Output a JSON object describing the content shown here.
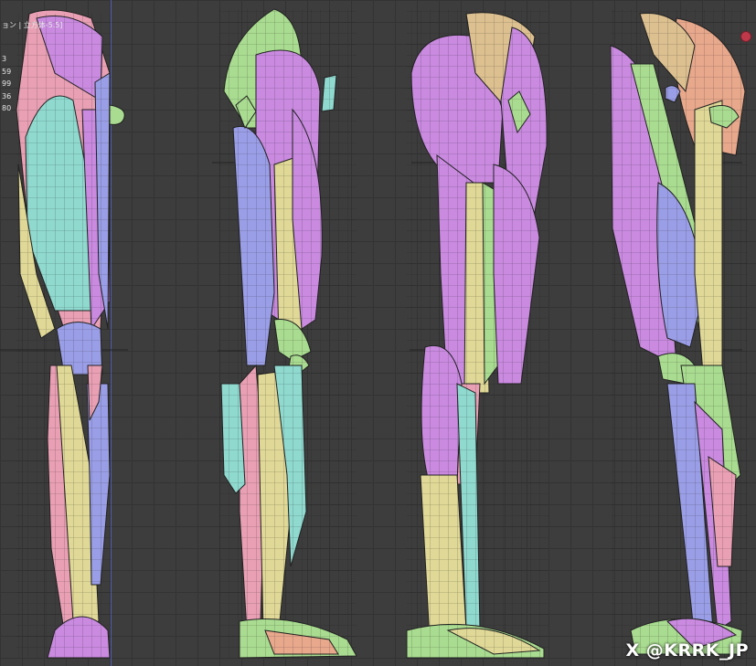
{
  "viewport": {
    "header_label": "ョン | 立方体-5.5]",
    "stats": [
      "3",
      "59",
      "99",
      "36",
      "80"
    ],
    "watermark": "X @KRRK_JP"
  },
  "colors": {
    "background": "#3d3d3d",
    "grid": "#333333",
    "purple": "#c98ae0",
    "pink": "#e9a0b4",
    "cyan": "#8fd9cf",
    "yellow": "#e0d896",
    "green": "#a9dc90",
    "blue": "#9a9ee6",
    "peach": "#e8a88c",
    "tan": "#dcc090"
  },
  "views": [
    "front-view",
    "side-view-right",
    "back-view",
    "side-view-left"
  ]
}
